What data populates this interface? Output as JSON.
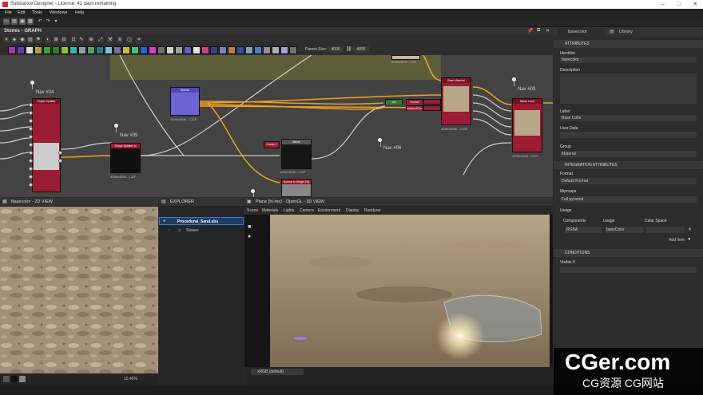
{
  "window": {
    "title": "Substance Designer - License: 41 days remaining"
  },
  "menu": [
    "File",
    "Edit",
    "Tools",
    "Windows",
    "Help"
  ],
  "graph": {
    "title": "Stones - GRAPH",
    "parent_size_label": "Parent Size:",
    "parent_size_w": "4096",
    "parent_size_h": "4096",
    "nav_labels": [
      "Nav #04",
      "Nav #05",
      "Nav #06",
      "Nav #09"
    ],
    "node_titles": [
      "Shape Splatter",
      "Normal",
      "Shape Splatter to Mask",
      "Blend",
      "Base Material",
      "Noise Level",
      "Normal to Height HQ",
      "Clamp 2"
    ],
    "node_sizes": [
      "4096x4096 - L32F",
      "4096x4096 - L32F",
      "4096x4096 - C32F",
      "4096x4096 - L32F",
      "4096x4096 - C32F",
      "4096x4096 - C32F",
      "4096x4096 - C16"
    ],
    "port_labels": [
      "out",
      "Normal",
      "ambientOcc"
    ]
  },
  "view2d": {
    "title": "Basecolor - 2D VIEW",
    "zoom": "10.45%"
  },
  "explorer": {
    "title": "EXPLORER",
    "package": "Procedural_Sand.sbs",
    "graph": "Stones"
  },
  "view3d": {
    "title": "Plane (hi-res) - OpenGL - 3D VIEW",
    "tabs": [
      "Scene",
      "Materials",
      "Lights",
      "Camera",
      "Environment",
      "Display",
      "Renderer"
    ],
    "colorspace": "sRGB (default)"
  },
  "right_panel": {
    "tab_active": "basecolor",
    "tab_library": "Library",
    "attributes_header": "ATTRIBUTES",
    "identifier_label": "Identifier",
    "identifier_value": "basecolor",
    "description_label": "Description",
    "label_label": "Label",
    "label_value": "Base Color",
    "userdata_label": "User Data",
    "group_label": "Group",
    "group_value": "Material",
    "integration_header": "INTEGRATION ATTRIBUTES",
    "format_label": "Format",
    "format_value": "Default Format",
    "mipmaps_label": "Mipmaps",
    "mipmaps_value": "Full pyramid",
    "usage_label": "Usage",
    "col_components": "Components",
    "col_usage": "Usage",
    "col_colorspace": "Color Space",
    "row_components": "RGBA",
    "row_usage": "baseColor",
    "add_item": "Add Item",
    "conditions_header": "CONDITIONS",
    "visible_if_label": "Visible If"
  },
  "watermark": {
    "line1": "CGer.com",
    "line2": "CG资源 CG网站"
  },
  "colors": {
    "node_red": "#9b1b30",
    "wire_orange": "#f0a020",
    "accent": "#3c78d8"
  }
}
